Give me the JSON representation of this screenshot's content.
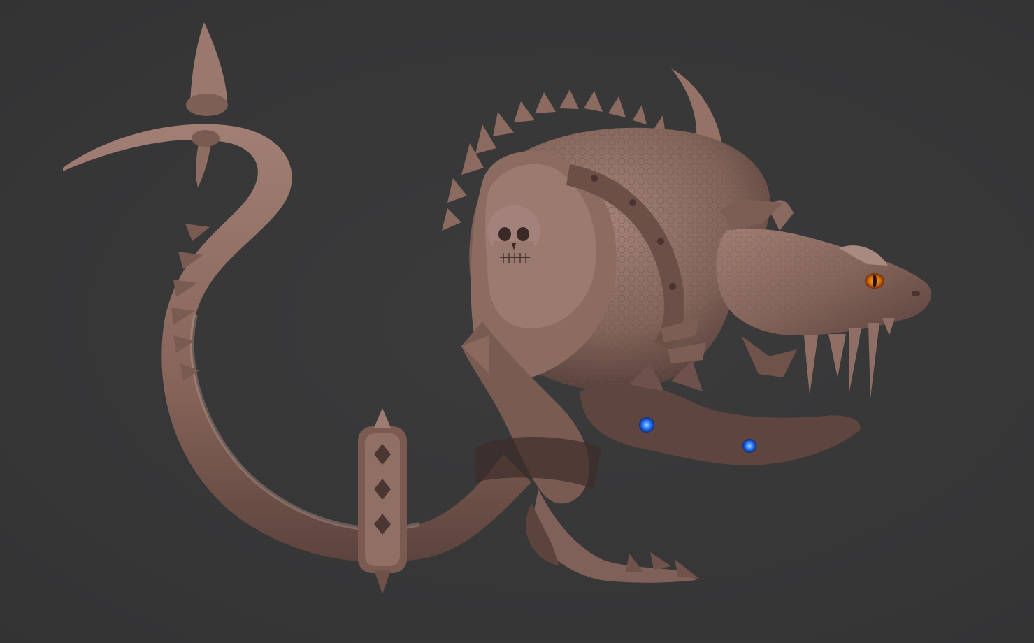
{
  "scene": {
    "subject": "",
    "background_color": "#38383a",
    "clay_color": "#8c6a60",
    "clay_shadow_color": "#4a3532",
    "clay_highlight_color": "#b38f84",
    "eye_color": "#d07a1a",
    "gem_color": "#2f7bff"
  }
}
